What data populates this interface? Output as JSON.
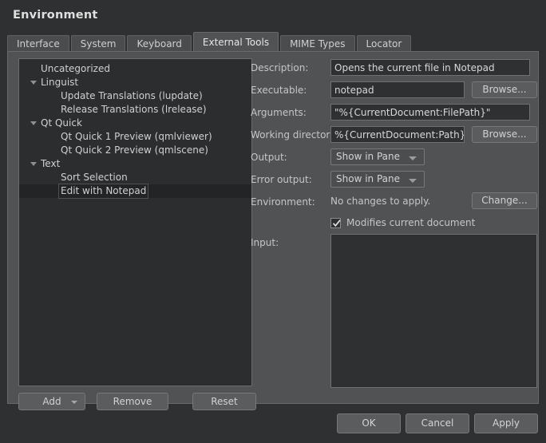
{
  "window": {
    "title": "Environment"
  },
  "tabs": [
    {
      "label": "Interface",
      "selected": false
    },
    {
      "label": "System",
      "selected": false
    },
    {
      "label": "Keyboard",
      "selected": false
    },
    {
      "label": "External Tools",
      "selected": true
    },
    {
      "label": "MIME Types",
      "selected": false
    },
    {
      "label": "Locator",
      "selected": false
    }
  ],
  "tree": {
    "items": [
      {
        "label": "Uncategorized",
        "level": 1,
        "expandable": false,
        "selected": false
      },
      {
        "label": "Linguist",
        "level": 1,
        "expandable": true,
        "selected": false
      },
      {
        "label": "Update Translations (lupdate)",
        "level": 2,
        "expandable": false,
        "selected": false
      },
      {
        "label": "Release Translations (lrelease)",
        "level": 2,
        "expandable": false,
        "selected": false
      },
      {
        "label": "Qt Quick",
        "level": 1,
        "expandable": true,
        "selected": false
      },
      {
        "label": "Qt Quick 1 Preview (qmlviewer)",
        "level": 2,
        "expandable": false,
        "selected": false
      },
      {
        "label": "Qt Quick 2 Preview (qmlscene)",
        "level": 2,
        "expandable": false,
        "selected": false
      },
      {
        "label": "Text",
        "level": 1,
        "expandable": true,
        "selected": false
      },
      {
        "label": "Sort Selection",
        "level": 2,
        "expandable": false,
        "selected": false
      },
      {
        "label": "Edit with Notepad",
        "level": 2,
        "expandable": false,
        "selected": true
      }
    ]
  },
  "left_buttons": {
    "add": "Add",
    "remove": "Remove",
    "reset": "Reset"
  },
  "form": {
    "description_label": "Description:",
    "description_value": "Opens the current file in Notepad",
    "executable_label": "Executable:",
    "executable_value": "notepad",
    "executable_browse": "Browse...",
    "arguments_label": "Arguments:",
    "arguments_value": "\"%{CurrentDocument:FilePath}\"",
    "working_directory_label": "Working directory:",
    "working_directory_value": "%{CurrentDocument:Path}",
    "working_directory_browse": "Browse...",
    "output_label": "Output:",
    "output_value": "Show in Pane",
    "error_output_label": "Error output:",
    "error_output_value": "Show in Pane",
    "environment_label": "Environment:",
    "environment_value": "No changes to apply.",
    "environment_change": "Change...",
    "modifies_document_label": "Modifies current document",
    "modifies_document_checked": true,
    "input_label": "Input:",
    "input_value": ""
  },
  "dialog_buttons": {
    "ok": "OK",
    "cancel": "Cancel",
    "apply": "Apply"
  },
  "colors": {
    "window_background": "#2e3032",
    "panel_background": "#515254",
    "tree_background": "#2b2d2e",
    "field_background": "#2e3032",
    "button_background": "#5a5c5e",
    "text": "#c8c8c8"
  }
}
